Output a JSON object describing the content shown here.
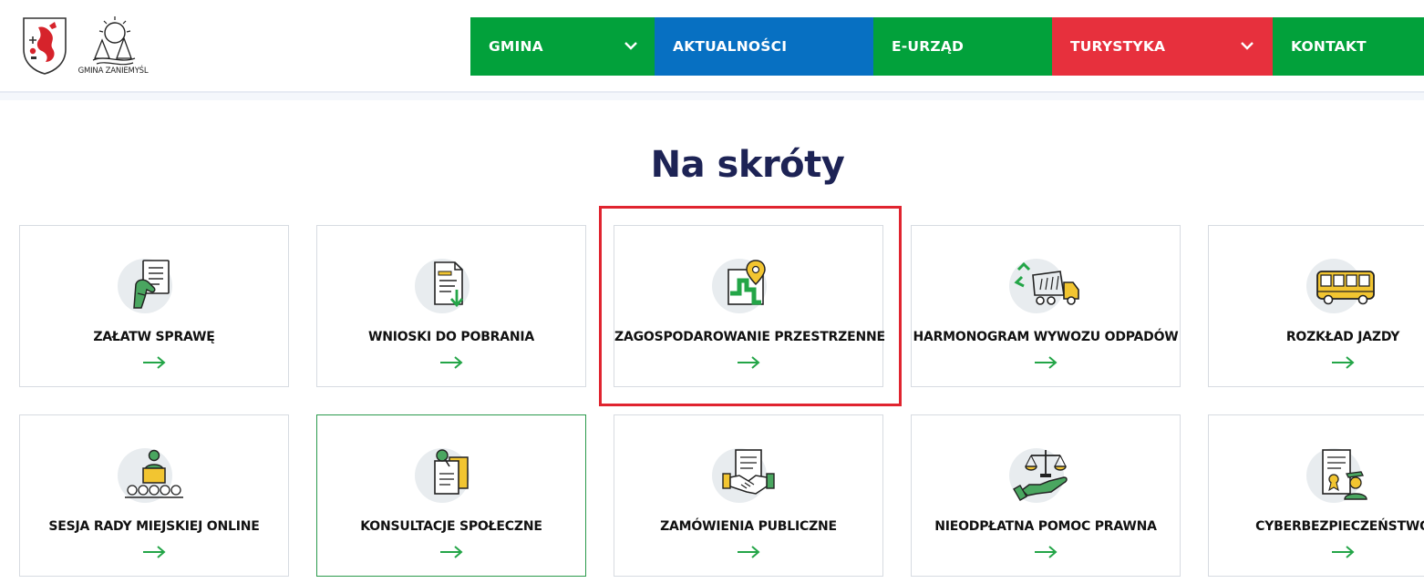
{
  "header": {
    "logo_text": "GMINA ZANIEMYŚL",
    "nav": [
      {
        "label": "GMINA",
        "has_dropdown": true,
        "color": "#02a13b"
      },
      {
        "label": "AKTUALNOŚCI",
        "has_dropdown": false,
        "color": "#0770c2"
      },
      {
        "label": "E-URZĄD",
        "has_dropdown": false,
        "color": "#02a13b"
      },
      {
        "label": "TURYSTYKA",
        "has_dropdown": true,
        "color": "#e7303d"
      },
      {
        "label": "KONTAKT",
        "has_dropdown": false,
        "color": "#02a13b"
      }
    ]
  },
  "shortcuts": {
    "title": "Na skróty",
    "items": [
      {
        "label": "ZAŁATW SPRAWĘ",
        "icon": "hand-document-icon"
      },
      {
        "label": "WNIOSKI DO POBRANIA",
        "icon": "document-download-icon"
      },
      {
        "label": "ZAGOSPODAROWANIE PRZESTRZENNE",
        "icon": "map-pin-icon",
        "highlighted": true
      },
      {
        "label": "HARMONOGRAM WYWOZU ODPADÓW",
        "icon": "garbage-truck-icon"
      },
      {
        "label": "ROZKŁAD JAZDY",
        "icon": "bus-icon"
      },
      {
        "label": "SESJA RADY MIEJSKIEJ ONLINE",
        "icon": "speaker-podium-icon"
      },
      {
        "label": "KONSULTACJE SPOŁECZNE",
        "icon": "pinned-notes-icon",
        "active": true
      },
      {
        "label": "ZAMÓWIENIA PUBLICZNE",
        "icon": "handshake-document-icon"
      },
      {
        "label": "NIEODPŁATNA POMOC PRAWNA",
        "icon": "scales-hand-icon"
      },
      {
        "label": "CYBERBEZPIECZEŃSTWO",
        "icon": "certificate-officer-icon"
      }
    ]
  },
  "colors": {
    "accent_green": "#02a13b",
    "accent_blue": "#0770c2",
    "accent_red": "#e7303d",
    "title_navy": "#1d2355",
    "icon_yellow": "#f2c531",
    "highlight_red": "#e0242f"
  }
}
